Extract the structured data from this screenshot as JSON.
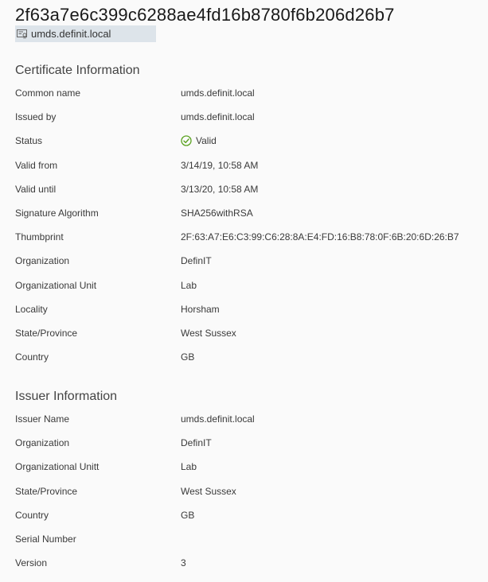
{
  "header": {
    "title": "2f63a7e6c399c6288ae4fd16b8780f6b206d26b7",
    "subtitle": "umds.definit.local",
    "subtitle_icon": "certificate-icon"
  },
  "certificate": {
    "section_title": "Certificate Information",
    "rows": [
      {
        "label": "Common name",
        "value": "umds.definit.local"
      },
      {
        "label": "Issued by",
        "value": "umds.definit.local"
      },
      {
        "label": "Status",
        "value": "Valid",
        "icon": "check-circle-icon",
        "status_color": "#5aa220"
      },
      {
        "label": "Valid from",
        "value": "3/14/19, 10:58 AM"
      },
      {
        "label": "Valid until",
        "value": "3/13/20, 10:58 AM"
      },
      {
        "label": "Signature Algorithm",
        "value": "SHA256withRSA"
      },
      {
        "label": "Thumbprint",
        "value": "2F:63:A7:E6:C3:99:C6:28:8A:E4:FD:16:B8:78:0F:6B:20:6D:26:B7"
      },
      {
        "label": "Organization",
        "value": "DefinIT"
      },
      {
        "label": "Organizational Unit",
        "value": "Lab"
      },
      {
        "label": "Locality",
        "value": "Horsham"
      },
      {
        "label": "State/Province",
        "value": "West Sussex"
      },
      {
        "label": "Country",
        "value": "GB"
      }
    ]
  },
  "issuer": {
    "section_title": "Issuer Information",
    "rows": [
      {
        "label": "Issuer Name",
        "value": "umds.definit.local"
      },
      {
        "label": "Organization",
        "value": "DefinIT"
      },
      {
        "label": "Organizational Unitt",
        "value": "Lab"
      },
      {
        "label": "State/Province",
        "value": "West Sussex"
      },
      {
        "label": "Country",
        "value": "GB"
      },
      {
        "label": "Serial Number",
        "value": ""
      },
      {
        "label": "Version",
        "value": "3"
      }
    ]
  }
}
